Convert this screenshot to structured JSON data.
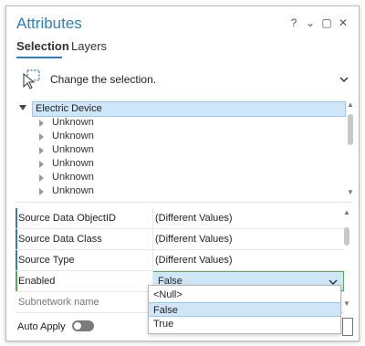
{
  "window": {
    "title": "Attributes",
    "controls": {
      "help": "?",
      "menu": "⌄",
      "restore": "▢",
      "close": "✕"
    }
  },
  "tabs": [
    {
      "label": "Selection",
      "active": true
    },
    {
      "label": "Layers",
      "active": false
    }
  ],
  "selection_bar": {
    "text": "Change the selection.",
    "icon": "select-cursor-icon"
  },
  "tree": {
    "root": "Electric Device",
    "children": [
      "Unknown",
      "Unknown",
      "Unknown",
      "Unknown",
      "Unknown",
      "Unknown"
    ]
  },
  "attributes": [
    {
      "label": "Source Data ObjectID",
      "value": "(Different Values)"
    },
    {
      "label": "Source Data Class",
      "value": "(Different Values)"
    },
    {
      "label": "Source Type",
      "value": "(Different Values)"
    },
    {
      "label": "Enabled",
      "value": "False"
    },
    {
      "label": "Subnetwork name",
      "value": ""
    }
  ],
  "dropdown": {
    "options": [
      "<Null>",
      "False",
      "True"
    ],
    "selected": "False"
  },
  "footer": {
    "auto_apply_label": "Auto Apply",
    "auto_apply_on": false
  },
  "colors": {
    "accent": "#2f7fc1",
    "selection": "#cfe6f8",
    "enabled_border": "#5aa85a"
  }
}
